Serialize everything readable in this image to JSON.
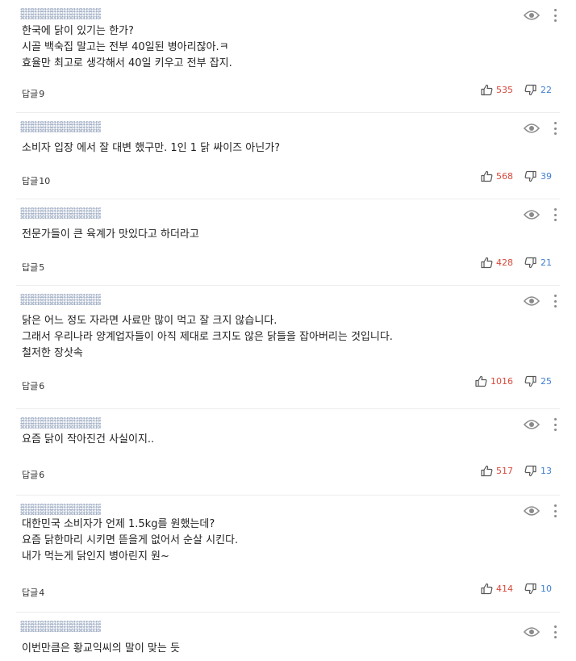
{
  "icons": {
    "eye": "eye-icon",
    "more": "more-vertical-icon",
    "like": "thumbs-up-icon",
    "dislike": "thumbs-down-icon"
  },
  "colors": {
    "likes": "#d6493b",
    "dislikes": "#3f7fd0"
  },
  "reply_label": "답글",
  "comments": [
    {
      "text": "한국에 닭이 있기는 한가?\n시골 백숙집 말고는 전부 40일된 병아리잖아.ㅋ\n효율만 최고로 생각해서 40일 키우고 전부 잡지.",
      "replies": "9",
      "likes": "535",
      "dislikes": "22"
    },
    {
      "text": "소비자 입장 에서  잘  대변 했구만.   1인  1 닭 싸이즈  아닌가?",
      "replies": "10",
      "likes": "568",
      "dislikes": "39"
    },
    {
      "text": "전문가들이 큰 육계가 맛있다고 하더라고",
      "replies": "5",
      "likes": "428",
      "dislikes": "21"
    },
    {
      "text": "닭은 어느 정도 자라면 사료만 많이 먹고 잘 크지 않습니다.\n그래서 우리나라 양계업자들이 아직 제대로 크지도 않은 닭들을 잡아버리는 것입니다.\n철저한 장삿속",
      "replies": "6",
      "likes": "1016",
      "dislikes": "25"
    },
    {
      "text": "요즘 닭이 작아진건 사실이지..",
      "replies": "6",
      "likes": "517",
      "dislikes": "13"
    },
    {
      "text": "대한민국 소비자가 언제 1.5kg를 원했는데?\n요즘 닭한마리 시키면 뜯을게 없어서 순살 시킨다.\n내가 먹는게 닭인지 병아린지 원~",
      "replies": "4",
      "likes": "414",
      "dislikes": "10"
    },
    {
      "text": "이번만큼은 황교익씨의 말이 맞는 듯",
      "replies": "",
      "likes": "",
      "dislikes": ""
    }
  ]
}
